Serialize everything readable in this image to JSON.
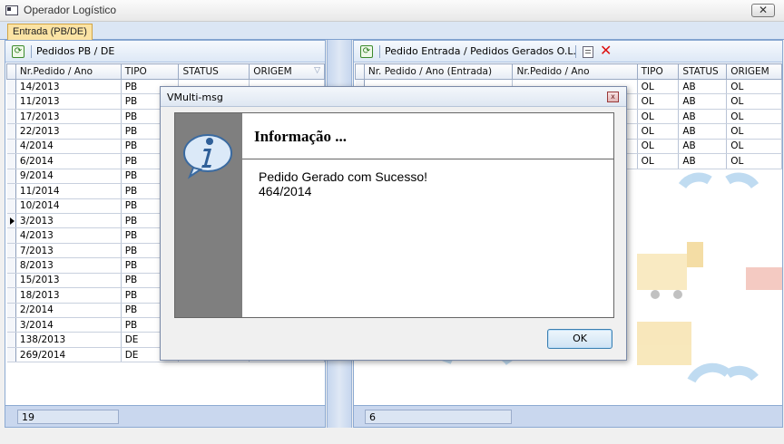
{
  "window": {
    "title": "Operador Logístico",
    "close_label": "✕"
  },
  "tabs": [
    {
      "label": "Entrada (PB/DE)"
    }
  ],
  "left_panel": {
    "title": "Pedidos PB / DE",
    "columns": [
      "Nr.Pedido / Ano",
      "TIPO",
      "STATUS",
      "ORIGEM"
    ],
    "filter_icon": "▽",
    "rows": [
      [
        "14/2013",
        "PB"
      ],
      [
        "11/2013",
        "PB"
      ],
      [
        "17/2013",
        "PB"
      ],
      [
        "22/2013",
        "PB"
      ],
      [
        "4/2014",
        "PB"
      ],
      [
        "6/2014",
        "PB"
      ],
      [
        "9/2014",
        "PB"
      ],
      [
        "11/2014",
        "PB"
      ],
      [
        "10/2014",
        "PB"
      ],
      [
        "3/2013",
        "PB"
      ],
      [
        "4/2013",
        "PB"
      ],
      [
        "7/2013",
        "PB"
      ],
      [
        "8/2013",
        "PB"
      ],
      [
        "15/2013",
        "PB"
      ],
      [
        "18/2013",
        "PB"
      ],
      [
        "2/2014",
        "PB"
      ],
      [
        "3/2014",
        "PB"
      ],
      [
        "138/2013",
        "DE"
      ],
      [
        "269/2014",
        "DE"
      ]
    ],
    "selected_row_index": 9,
    "count": "19"
  },
  "right_panel": {
    "title": "Pedido Entrada / Pedidos Gerados O.L.",
    "columns": [
      "Nr. Pedido / Ano (Entrada)",
      "Nr.Pedido / Ano",
      "TIPO",
      "STATUS",
      "ORIGEM"
    ],
    "rows": [
      [
        "",
        "",
        "OL",
        "AB",
        "OL"
      ],
      [
        "",
        "",
        "OL",
        "AB",
        "OL"
      ],
      [
        "",
        "",
        "OL",
        "AB",
        "OL"
      ],
      [
        "",
        "",
        "OL",
        "AB",
        "OL"
      ],
      [
        "",
        "",
        "OL",
        "AB",
        "OL"
      ],
      [
        "",
        "",
        "OL",
        "AB",
        "OL"
      ]
    ],
    "count": "6"
  },
  "dialog": {
    "title": "VMulti-msg",
    "close_label": "x",
    "heading": "Informação ...",
    "message_line1": "Pedido Gerado com Sucesso!",
    "message_line2": "464/2014",
    "ok_label": "OK",
    "icon": "info-icon"
  },
  "colors": {
    "accent": "#8caad2",
    "tab_active": "#fbe3a4",
    "delete": "#dd1111"
  }
}
